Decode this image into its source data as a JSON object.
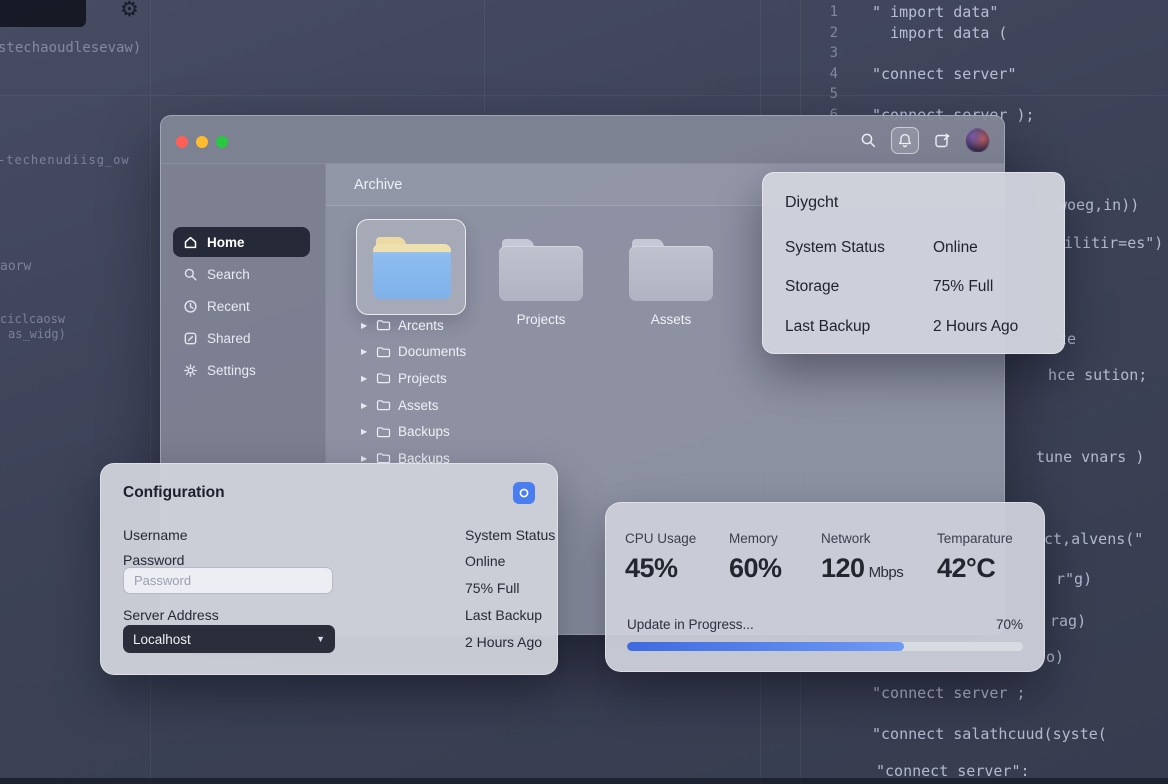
{
  "icons": {
    "caret_right": "▶",
    "caret_down": "▼",
    "gear": "⚙"
  },
  "background": {
    "code": {
      "lines": [
        {
          "n": "1",
          "t": "\" import data\""
        },
        {
          "n": "2",
          "t": "  import data ("
        },
        {
          "n": "3",
          "t": ""
        },
        {
          "n": "4",
          "t": "\"connect server\""
        },
        {
          "n": "5",
          "t": ""
        },
        {
          "n": "6",
          "t": "\"connect server );"
        }
      ],
      "fragments": [
        {
          "t": "woeg,in))"
        },
        {
          "t": "ilitir=es\")"
        },
        {
          "t": "te"
        },
        {
          "t": "hce sution;"
        },
        {
          "t": "tune vnars )"
        },
        {
          "t": "ct,alvens(\""
        },
        {
          "t": "r\"g)"
        },
        {
          "t": "rag)"
        },
        {
          "t": "o)"
        }
      ],
      "bottom": [
        {
          "t": "\"connect server ;"
        },
        {
          "t": "\"connect salathcuud(syste("
        },
        {
          "t": "\"connect server\":"
        }
      ],
      "left": [
        {
          "t": "stechaoudlesevaw)"
        },
        {
          "t": "-techenudiisg_ow"
        },
        {
          "t": "aorw"
        },
        {
          "t": "ciclcaosw"
        },
        {
          "t": "as_widg)"
        }
      ]
    }
  },
  "window": {
    "sidebar": {
      "items": [
        {
          "label": "Home"
        },
        {
          "label": "Search"
        },
        {
          "label": "Recent"
        },
        {
          "label": "Shared"
        },
        {
          "label": "Settings"
        }
      ]
    },
    "content": {
      "header": "Archive",
      "tiles": [
        {
          "label": "Projects"
        },
        {
          "label": "Assets"
        }
      ],
      "tree": [
        {
          "label": "Arcents"
        },
        {
          "label": "Documents"
        },
        {
          "label": "Projects"
        },
        {
          "label": "Assets"
        },
        {
          "label": "Backups"
        },
        {
          "label": "Backups"
        }
      ]
    }
  },
  "popover": {
    "title": "Diygcht",
    "rows": [
      {
        "label": "System Status",
        "value": "Online"
      },
      {
        "label": "Storage",
        "value": "75% Full"
      },
      {
        "label": "Last Backup",
        "value": "2 Hours Ago"
      }
    ]
  },
  "config": {
    "title": "Configuration",
    "username_label": "Username",
    "password_label": "Password",
    "password_placeholder": "Password",
    "server_label": "Server Address",
    "server_value": "Localhost",
    "status_lines": [
      {
        "t": "System Status"
      },
      {
        "t": "Online"
      },
      {
        "t": "75% Full"
      },
      {
        "t": "Last Backup"
      },
      {
        "t": "2 Hours Ago"
      }
    ]
  },
  "stats": {
    "metrics": [
      {
        "label": "CPU Usage",
        "value": "45%",
        "unit": ""
      },
      {
        "label": "Memory",
        "value": "60%",
        "unit": ""
      },
      {
        "label": "Network",
        "value": "120",
        "unit": "Mbps"
      },
      {
        "label": "Temparature",
        "value": "42°C",
        "unit": ""
      }
    ],
    "progress": {
      "label": "Update in Progress...",
      "percent": 70,
      "percent_label": "70%"
    }
  },
  "colors": {
    "accent": "#4a7df0",
    "folder_blue": "#84b7ec",
    "window_gray": "#969bab",
    "traffic_red": "#ff5f57",
    "traffic_yellow": "#febc2e",
    "traffic_green": "#28c840"
  }
}
